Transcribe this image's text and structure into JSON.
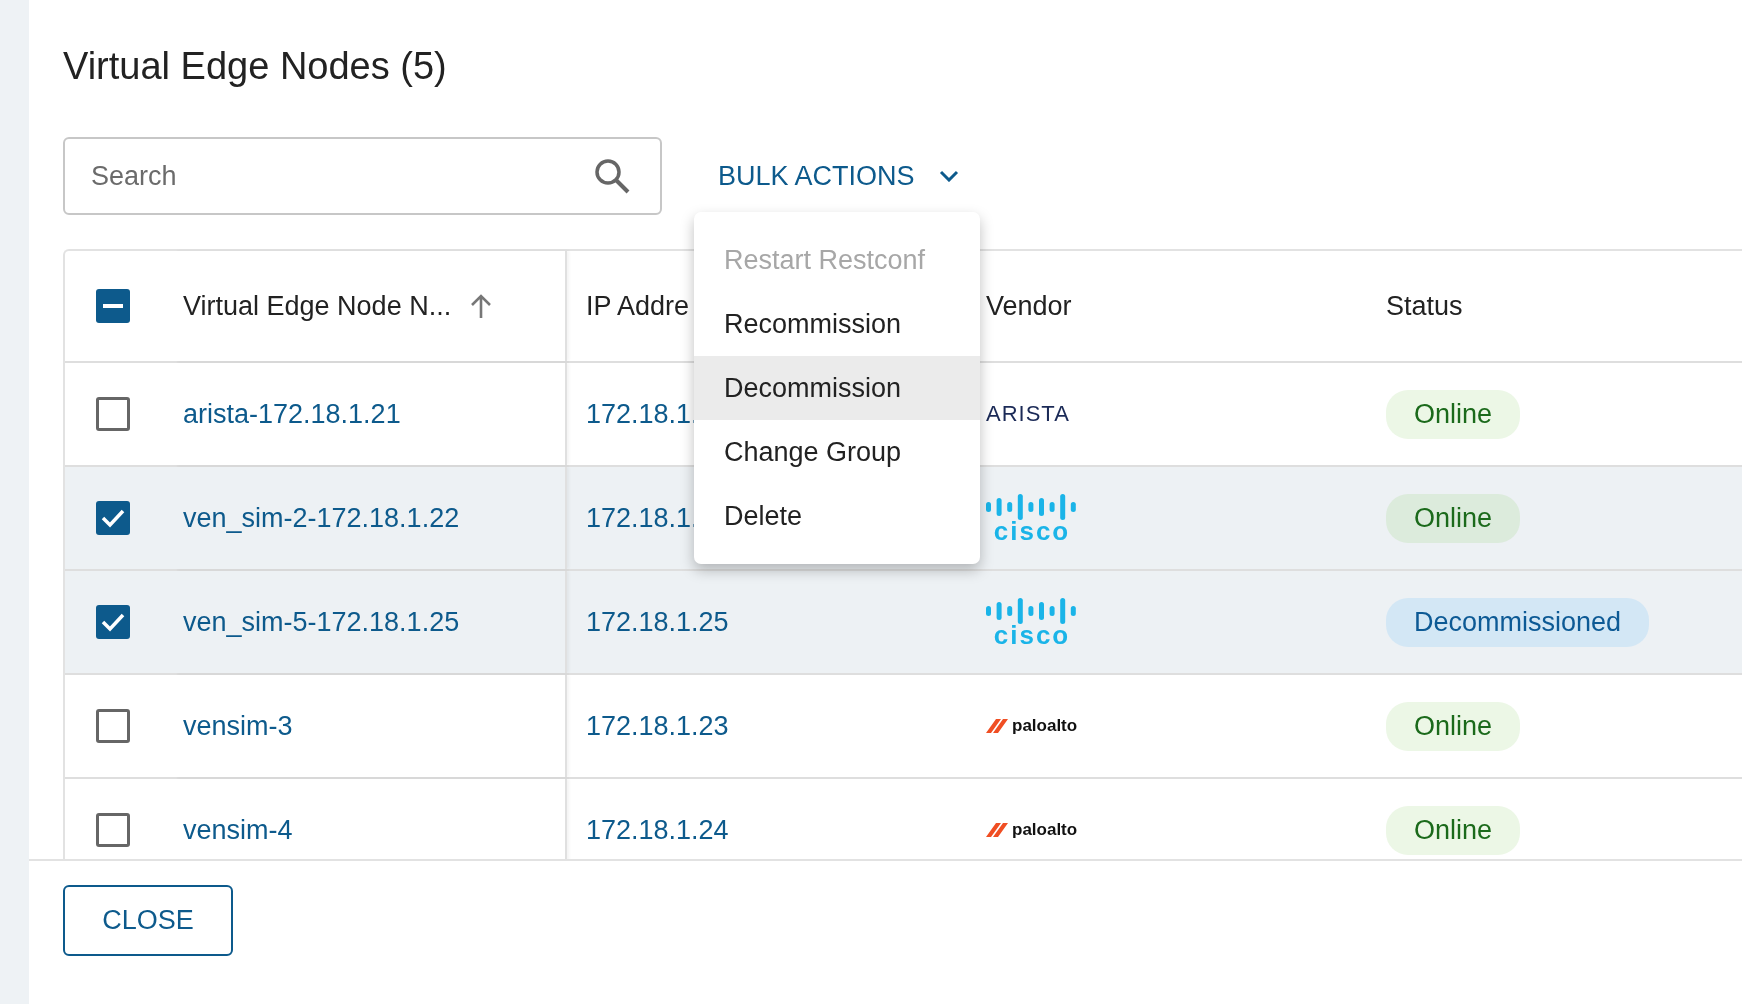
{
  "dialog": {
    "title": "Virtual Edge Nodes (5)"
  },
  "search": {
    "placeholder": "Search"
  },
  "bulk_actions": {
    "label": "BULK ACTIONS",
    "expanded": true
  },
  "menu": [
    {
      "label": "Restart Restconf",
      "disabled": true,
      "highlighted": false
    },
    {
      "label": "Recommission",
      "disabled": false,
      "highlighted": false
    },
    {
      "label": "Decommission",
      "disabled": false,
      "highlighted": true
    },
    {
      "label": "Change Group",
      "disabled": false,
      "highlighted": false
    },
    {
      "label": "Delete",
      "disabled": false,
      "highlighted": false
    }
  ],
  "table": {
    "select_all": {
      "indeterminate": true
    },
    "columns": [
      {
        "label": "Virtual Edge Node N...",
        "sorted_ascending": true
      },
      {
        "label": "IP Addre",
        "sorted_ascending": false
      },
      {
        "label": "Vendor",
        "sorted_ascending": false
      },
      {
        "label": "Status",
        "sorted_ascending": false
      }
    ],
    "rows": [
      {
        "name": "arista-172.18.1.21",
        "ip": "172.18.1.",
        "vendor": {
          "kind": "arista",
          "logo_text": "ARISTA"
        },
        "status": {
          "kind": "online",
          "label": "Online"
        },
        "selected": false
      },
      {
        "name": "ven_sim-2-172.18.1.22",
        "ip": "172.18.1.",
        "vendor": {
          "kind": "cisco",
          "logo_text": "cisco"
        },
        "status": {
          "kind": "online",
          "label": "Online"
        },
        "selected": true
      },
      {
        "name": "ven_sim-5-172.18.1.25",
        "ip": "172.18.1.25",
        "vendor": {
          "kind": "cisco",
          "logo_text": "cisco"
        },
        "status": {
          "kind": "decommissioned",
          "label": "Decommissioned"
        },
        "selected": true
      },
      {
        "name": "vensim-3",
        "ip": "172.18.1.23",
        "vendor": {
          "kind": "paloalto",
          "logo_text": "paloalto"
        },
        "status": {
          "kind": "online",
          "label": "Online"
        },
        "selected": false
      },
      {
        "name": "vensim-4",
        "ip": "172.18.1.24",
        "vendor": {
          "kind": "paloalto",
          "logo_text": "paloalto"
        },
        "status": {
          "kind": "online",
          "label": "Online"
        },
        "selected": false
      }
    ]
  },
  "footer": {
    "close_label": "CLOSE"
  }
}
